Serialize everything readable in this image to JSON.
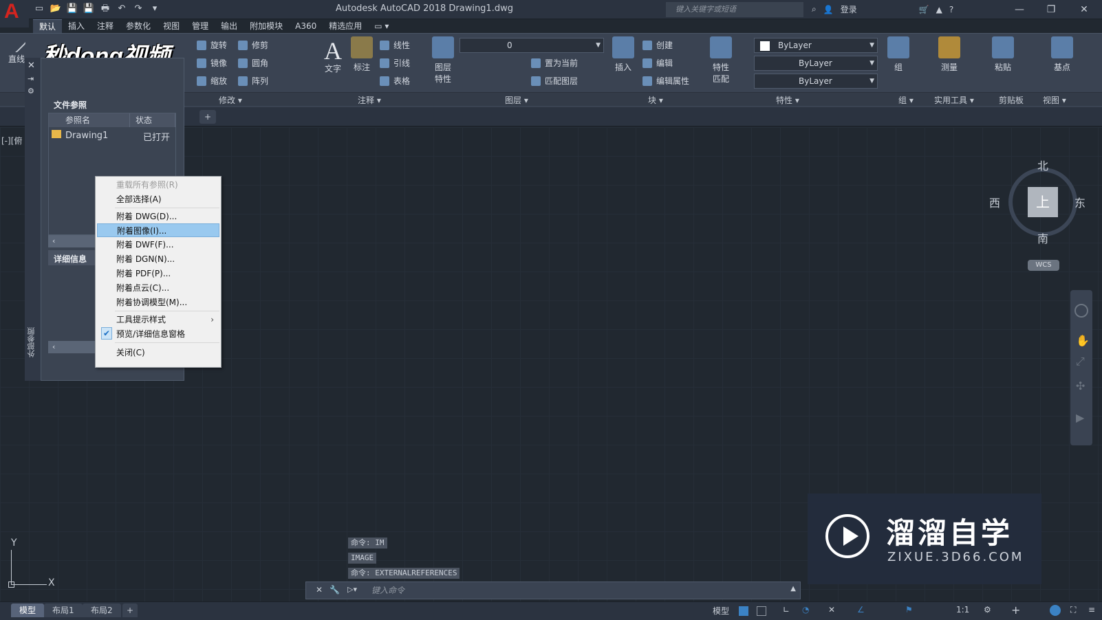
{
  "window": {
    "title": "Autodesk AutoCAD 2018    Drawing1.dwg",
    "search_placeholder": "键入关键字或短语",
    "login_label": "登录",
    "minimize": "—",
    "restore": "❐",
    "close": "✕"
  },
  "app_logo": "A",
  "quick_access": [
    "▭",
    "📂",
    "💾",
    "💾",
    "🖶",
    "↶",
    "↷",
    "▾"
  ],
  "menu_tabs": [
    "默认",
    "插入",
    "注释",
    "参数化",
    "视图",
    "管理",
    "输出",
    "附加模块",
    "A360",
    "精选应用",
    "▭ ▾"
  ],
  "ribbon": {
    "draw": {
      "line": "直线"
    },
    "modify": {
      "title": "修改 ▾",
      "rotate": "旋转",
      "trim": "修剪",
      "mirror": "镜像",
      "fillet": "圆角",
      "scale": "缩放",
      "array": "阵列"
    },
    "annotation": {
      "title": "注释 ▾",
      "text": "文字",
      "dimension": "标注",
      "linear": "线性",
      "leader": "引线",
      "table": "表格"
    },
    "layers": {
      "title": "图层 ▾",
      "layer_props": "图层\n特性",
      "layer_value": "0",
      "set_current": "置为当前",
      "match_layer": "匹配图层",
      "props_label": "图层",
      "props_label2": "特性"
    },
    "block": {
      "title": "块 ▾",
      "insert": "插入",
      "create": "创建",
      "edit": "编辑",
      "edit_attr": "编辑属性"
    },
    "properties": {
      "title": "特性 ▾",
      "match": "特性",
      "match2": "匹配",
      "color": "ByLayer",
      "linetype": "ByLayer",
      "lineweight": "ByLayer"
    },
    "groups": {
      "title": "组 ▾",
      "group": "组"
    },
    "utilities": {
      "title": "实用工具 ▾",
      "measure": "测量"
    },
    "clipboard": {
      "title": "剪贴板",
      "paste": "粘贴"
    },
    "view": {
      "title": "视图 ▾",
      "base": "基点"
    }
  },
  "viewport_label": "[-][俯",
  "xref": {
    "panel_title": "文件参照",
    "col_name": "参照名",
    "col_status": "状态",
    "row_name": "Drawing1",
    "row_status": "已打开",
    "details_title": "详细信息",
    "side_label": "外部参照"
  },
  "context_menu": {
    "items": [
      {
        "label": "重载所有参照(R)",
        "disabled": true
      },
      {
        "label": "全部选择(A)"
      },
      {
        "label": "附着 DWG(D)..."
      },
      {
        "label": "附着图像(I)...",
        "highlighted": true
      },
      {
        "label": "附着 DWF(F)..."
      },
      {
        "label": "附着 DGN(N)..."
      },
      {
        "label": "附着 PDF(P)..."
      },
      {
        "label": "附着点云(C)..."
      },
      {
        "label": "附着协调模型(M)..."
      },
      {
        "label": "工具提示样式",
        "submenu": "›"
      },
      {
        "label": "预览/详细信息窗格",
        "checked": "✔"
      },
      {
        "label": "关闭(C)"
      }
    ]
  },
  "watermark_logo": "秒dong视频",
  "viewcube": {
    "north": "北",
    "south": "南",
    "west": "西",
    "east": "东",
    "face": "上",
    "wcs": "WCS"
  },
  "ucs": {
    "x": "X",
    "y": "Y"
  },
  "command_history": [
    "命令: IM",
    "IMAGE",
    "命令: EXTERNALREFERENCES"
  ],
  "command_placeholder": "键入命令",
  "layout_tabs": [
    "模型",
    "布局1",
    "布局2",
    "+"
  ],
  "status": {
    "model": "模型",
    "scale": "1:1"
  },
  "site_watermark": {
    "name": "溜溜自学",
    "url": "ZIXUE.3D66.COM"
  }
}
